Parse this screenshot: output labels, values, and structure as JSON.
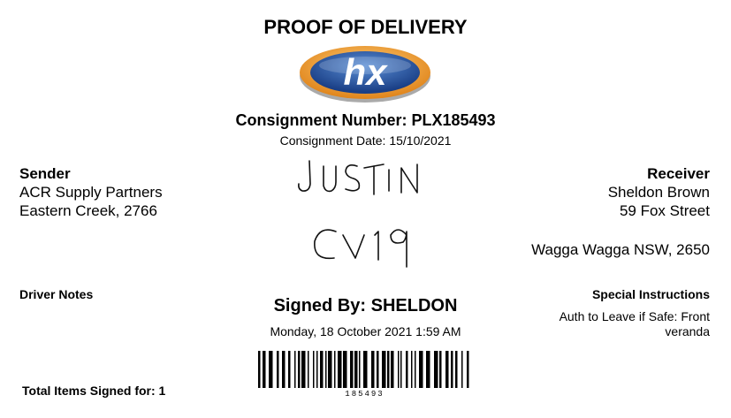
{
  "document": {
    "title": "PROOF OF DELIVERY",
    "logo_text": "hx",
    "consignment_number": "Consignment Number: PLX185493",
    "consignment_date": "Consignment Date: 15/10/2021"
  },
  "sender": {
    "heading": "Sender",
    "name": "ACR Supply Partners",
    "location": "Eastern Creek, 2766"
  },
  "receiver": {
    "heading": "Receiver",
    "name": "Sheldon Brown",
    "street": "59 Fox Street",
    "city": "Wagga Wagga NSW, 2650"
  },
  "signature": {
    "handwritten_line1": "JUSTIN",
    "handwritten_line2": "CV19",
    "signed_by": "Signed By: SHELDON",
    "signed_date": "Monday, 18 October 2021 1:59 AM"
  },
  "driver_notes": {
    "heading": "Driver Notes"
  },
  "special_instructions": {
    "heading": "Special Instructions",
    "text": "Auth to Leave if Safe: Front veranda"
  },
  "totals": {
    "label": "Total Items Signed for: 1"
  },
  "barcode": {
    "number": "185493"
  },
  "colors": {
    "logo_blue": "#1f4f9c",
    "logo_orange": "#f19b1c"
  }
}
